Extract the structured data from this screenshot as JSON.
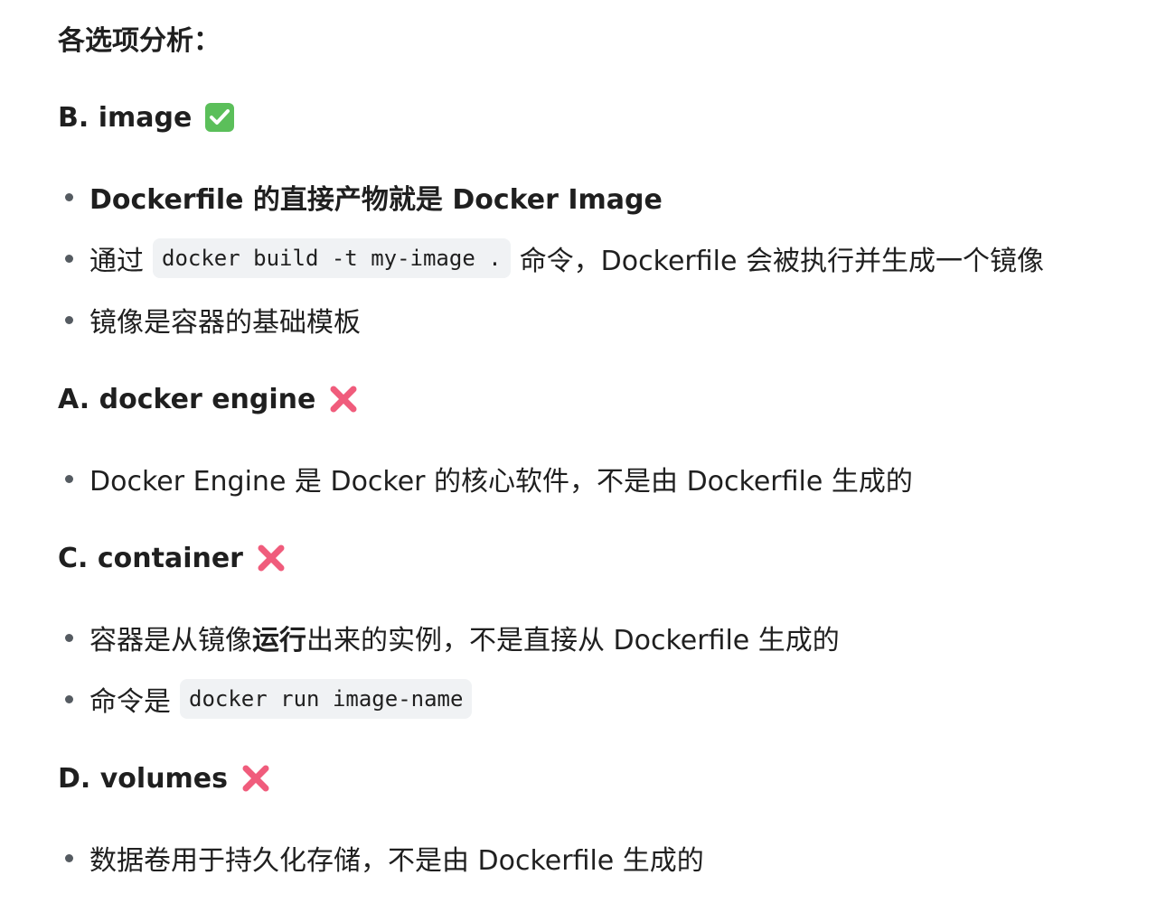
{
  "title": "各选项分析：",
  "sections": [
    {
      "heading": "B. image",
      "mark": "check-mark-icon",
      "bullets": [
        {
          "type": "bold",
          "text": "Dockerfile 的直接产物就是 Docker Image"
        },
        {
          "type": "code",
          "before": "通过",
          "code": "docker build -t my-image .",
          "after": "命令，Dockerfile 会被执行并生成一个镜像"
        },
        {
          "type": "plain",
          "text": "镜像是容器的基础模板"
        }
      ]
    },
    {
      "heading": "A. docker engine",
      "mark": "cross-mark-icon",
      "bullets": [
        {
          "type": "plain",
          "text": "Docker Engine 是 Docker 的核心软件，不是由 Dockerfile 生成的"
        }
      ]
    },
    {
      "heading": "C. container",
      "mark": "cross-mark-icon",
      "bullets": [
        {
          "type": "mixed",
          "before": "容器是从镜像",
          "bold": "运行",
          "after": "出来的实例，不是直接从 Dockerfile 生成的"
        },
        {
          "type": "code",
          "before": "命令是",
          "code": "docker run image-name",
          "after": ""
        }
      ]
    },
    {
      "heading": "D. volumes",
      "mark": "cross-mark-icon",
      "bullets": [
        {
          "type": "plain",
          "text": "数据卷用于持久化存储，不是由 Dockerfile 生成的"
        }
      ]
    }
  ],
  "colors": {
    "check": "#5bbf5a",
    "cross": "#f05c7c",
    "code_bg": "#f0f2f4",
    "bullet_dot": "#555b61"
  }
}
